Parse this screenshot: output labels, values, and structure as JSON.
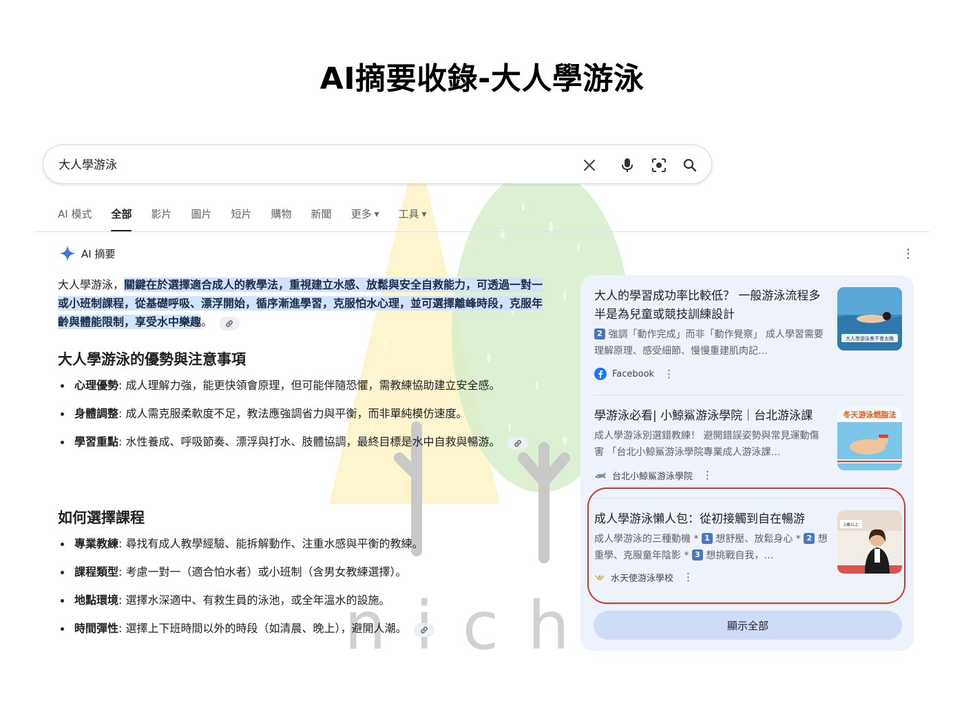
{
  "page_title": "AI摘要收錄-大人學游泳",
  "search": {
    "query": "大人學游泳",
    "icons": [
      "close-icon",
      "microphone-icon",
      "camera-lens-icon",
      "search-icon"
    ]
  },
  "tabs": [
    {
      "label": "AI 模式",
      "active": false
    },
    {
      "label": "全部",
      "active": true
    },
    {
      "label": "影片",
      "active": false
    },
    {
      "label": "圖片",
      "active": false
    },
    {
      "label": "短片",
      "active": false
    },
    {
      "label": "購物",
      "active": false
    },
    {
      "label": "新聞",
      "active": false
    },
    {
      "label": "更多",
      "active": false
    },
    {
      "label": "工具",
      "active": false
    }
  ],
  "ai_overview": {
    "header": "AI 摘要",
    "intro_plain": "大人學游泳，",
    "intro_highlight": "關鍵在於選擇適合成人的教學法，重視建立水感、放鬆與安全自救能力，可透過一對一或小班制課程，從基礎呼吸、漂浮開始，循序漸進學習，克服怕水心理，並可選擇離峰時段，克服年齡與體能限制，享受水中樂趣",
    "intro_end": "。",
    "section1": {
      "heading": "大人學游泳的優勢與注意事項",
      "items": [
        {
          "term": "心理優勢",
          "text": ": 成人理解力強，能更快領會原理，但可能伴隨恐懼，需教練協助建立安全感。"
        },
        {
          "term": "身體調整",
          "text": ": 成人需克服柔軟度不足，教法應強調省力與平衡，而非單純模仿速度。"
        },
        {
          "term": "學習重點",
          "text": ": 水性養成、呼吸節奏、漂浮與打水、肢體協調，最終目標是水中自救與暢游。"
        }
      ]
    },
    "section2": {
      "heading": "如何選擇課程",
      "items": [
        {
          "term": "專業教練",
          "text": ": 尋找有成人教學經驗、能拆解動作、注重水感與平衡的教練。"
        },
        {
          "term": "課程類型",
          "text": ": 考慮一對一（適合怕水者）或小班制（含男女教練選擇）。"
        },
        {
          "term": "地點環境",
          "text": ": 選擇水深適中、有救生員的泳池，或全年溫水的設施。"
        },
        {
          "term": "時間彈性",
          "text": ": 選擇上下班時間以外的時段（如清晨、晚上），避開人潮。"
        }
      ]
    }
  },
  "sources": {
    "cards": [
      {
        "title": "大人的學習成功率比較低？ 一般游泳流程多半是為兒童或競技訓練設計",
        "snippet_num": "2",
        "snippet": "強調「動作完成」而非「動作覺察」 成人學習需要理解原理、感受細節、慢慢重建肌肉記…",
        "source": "Facebook",
        "thumb_text": "大人學游泳會不會太晚"
      },
      {
        "title": "學游泳必看| 小鯨鯊游泳學院｜台北游泳課",
        "snippet": "成人學游泳別選錯教練！ 避開錯誤姿勢與常見運動傷害 「台北小鯨鯊游泳學院專業成人游泳課…",
        "source": "台北小鯨鯊游泳學院",
        "thumb_text": "冬天游泳燃脂法"
      },
      {
        "title": "成人學游泳懶人包：從初接觸到自在暢游",
        "snippet_a": "成人學游泳的三種動機 *",
        "n1": "1",
        "snippet_b": "想舒壓、放鬆身心 *",
        "n2": "2",
        "snippet_c": "想重學、克服童年陰影 *",
        "n3": "3",
        "snippet_d": "想挑戰自我，…",
        "source": "水天使游泳學校",
        "thumb_text": "2歲以上"
      }
    ],
    "show_all": "顯示全部"
  },
  "watermark_text": "nichi",
  "colors": {
    "highlight": "#d3e3fd",
    "sources_bg": "#eef2fb",
    "ring": "#d6342c",
    "tree_yellow": "#fdf3c4",
    "tree_green": "#d6ecc9"
  }
}
